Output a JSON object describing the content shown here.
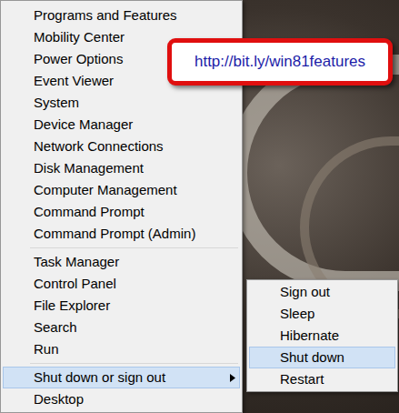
{
  "menu": {
    "groups": [
      {
        "items": [
          {
            "label": "Programs and Features",
            "selected": false,
            "kind": "item"
          },
          {
            "label": "Mobility Center",
            "selected": false,
            "kind": "item"
          },
          {
            "label": "Power Options",
            "selected": false,
            "kind": "item"
          },
          {
            "label": "Event Viewer",
            "selected": false,
            "kind": "item"
          },
          {
            "label": "System",
            "selected": false,
            "kind": "item"
          },
          {
            "label": "Device Manager",
            "selected": false,
            "kind": "item"
          },
          {
            "label": "Network Connections",
            "selected": false,
            "kind": "item"
          },
          {
            "label": "Disk Management",
            "selected": false,
            "kind": "item"
          },
          {
            "label": "Computer Management",
            "selected": false,
            "kind": "item"
          },
          {
            "label": "Command Prompt",
            "selected": false,
            "kind": "item"
          },
          {
            "label": "Command Prompt (Admin)",
            "selected": false,
            "kind": "item"
          }
        ]
      },
      {
        "items": [
          {
            "label": "Task Manager",
            "selected": false,
            "kind": "item"
          },
          {
            "label": "Control Panel",
            "selected": false,
            "kind": "item"
          },
          {
            "label": "File Explorer",
            "selected": false,
            "kind": "item"
          },
          {
            "label": "Search",
            "selected": false,
            "kind": "item"
          },
          {
            "label": "Run",
            "selected": false,
            "kind": "item"
          }
        ]
      },
      {
        "items": [
          {
            "label": "Shut down or sign out",
            "selected": true,
            "kind": "submenu"
          },
          {
            "label": "Desktop",
            "selected": false,
            "kind": "item"
          }
        ]
      }
    ]
  },
  "submenu": {
    "items": [
      {
        "label": "Sign out",
        "selected": false
      },
      {
        "label": "Sleep",
        "selected": false
      },
      {
        "label": "Hibernate",
        "selected": false
      },
      {
        "label": "Shut down",
        "selected": true
      },
      {
        "label": "Restart",
        "selected": false
      }
    ]
  },
  "callout": {
    "text": "http://bit.ly/win81features"
  }
}
